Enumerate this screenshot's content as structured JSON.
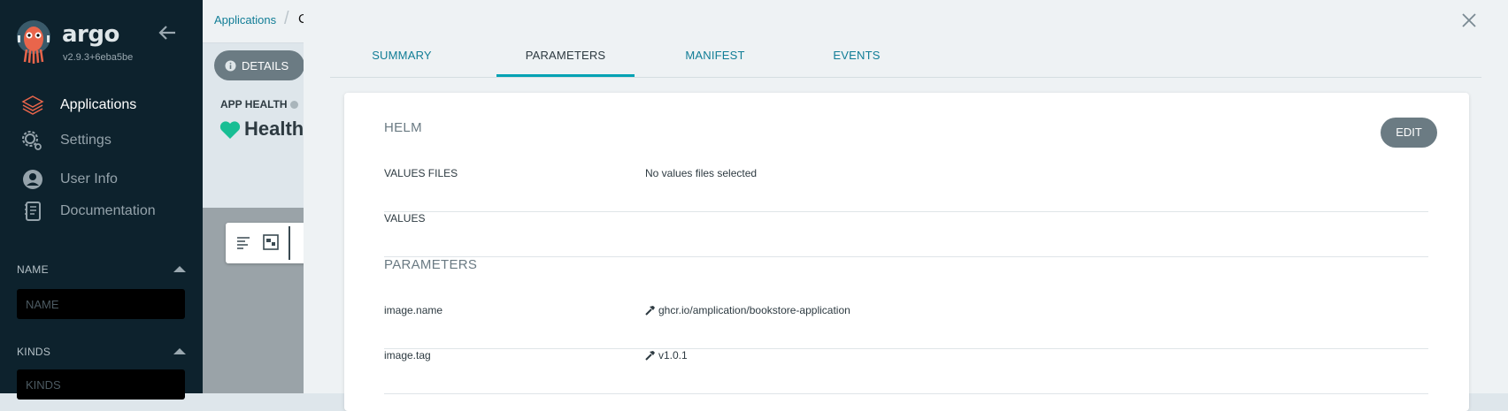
{
  "sidebar": {
    "brand": "argo",
    "version": "v2.9.3+6eba5be",
    "nav": [
      {
        "label": "Applications",
        "icon": "stack-icon",
        "active": true
      },
      {
        "label": "Settings",
        "icon": "gears-icon",
        "active": false
      },
      {
        "label": "User Info",
        "icon": "user-circle-icon",
        "active": false
      },
      {
        "label": "Documentation",
        "icon": "book-icon",
        "active": false
      }
    ],
    "filters": {
      "name_title": "NAME",
      "name_placeholder": "NAME",
      "kinds_title": "KINDS",
      "kinds_placeholder": "KINDS"
    }
  },
  "background": {
    "breadcrumb": "Applications",
    "breadcrumb_next": "C",
    "details_label": "DETAILS",
    "app_health_label": "APP HEALTH",
    "health_value": "Health"
  },
  "panel": {
    "tabs": [
      {
        "label": "SUMMARY",
        "active": false
      },
      {
        "label": "PARAMETERS",
        "active": true
      },
      {
        "label": "MANIFEST",
        "active": false
      },
      {
        "label": "EVENTS",
        "active": false
      }
    ],
    "helm_title": "HELM",
    "edit_label": "EDIT",
    "values_files": {
      "key": "VALUES FILES",
      "value": "No values files selected"
    },
    "values": {
      "key": "VALUES",
      "value": ""
    },
    "parameters_title": "PARAMETERS",
    "parameters": [
      {
        "key": "image.name",
        "value": "ghcr.io/amplication/bookstore-application"
      },
      {
        "key": "image.tag",
        "value": "v1.0.1"
      }
    ]
  },
  "colors": {
    "sidebar_bg": "#0d222d",
    "accent": "#00a2b3",
    "link": "#117d96",
    "health_green": "#18be94",
    "button_gray": "#6b7b83"
  }
}
